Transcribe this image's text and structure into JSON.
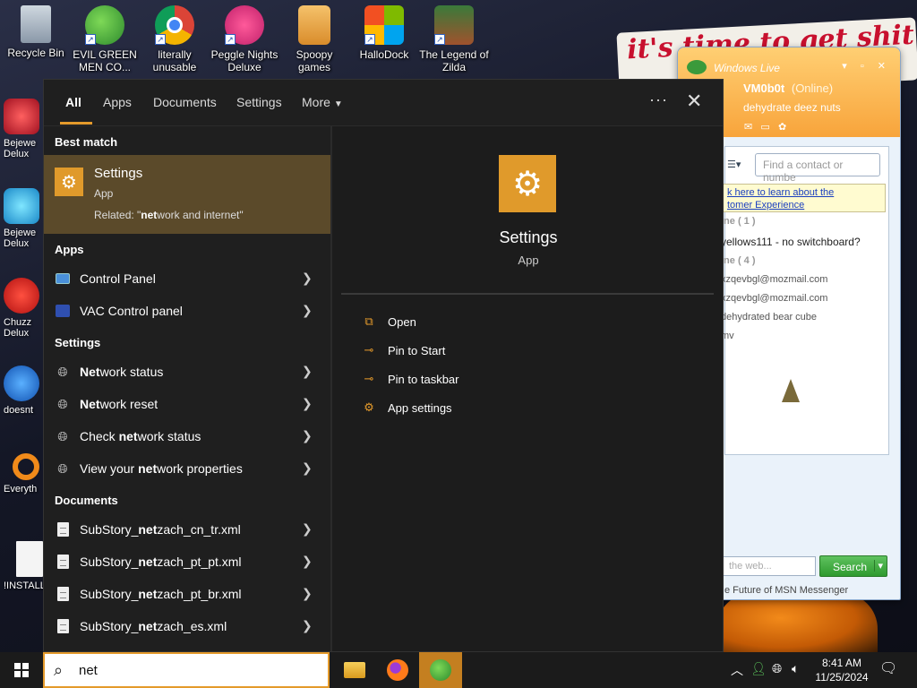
{
  "desktop": {
    "top_icons": [
      {
        "label": "Recycle Bin"
      },
      {
        "label": "EVIL GREEN MEN CO..."
      },
      {
        "label": "literally unusable"
      },
      {
        "label": "Peggle Nights Deluxe"
      },
      {
        "label": "Spoopy games"
      },
      {
        "label": "HalloDock"
      },
      {
        "label": "The Legend of Zilda"
      }
    ],
    "left_icons": [
      {
        "label": "Bejewe Delux"
      },
      {
        "label": "Bejewe Delux"
      },
      {
        "label": "Chuzz Delux"
      },
      {
        "label": "doesnt"
      },
      {
        "label": "Everyth"
      },
      {
        "label": "!INSTALL"
      }
    ],
    "wallpaper_text": "it's time to get shit"
  },
  "msn": {
    "title": "Windows Live",
    "username": "VM0b0t",
    "status": "(Online)",
    "personal_message": "dehydrate deez nuts",
    "find_placeholder": "Find a contact or numbe",
    "promo_line1": "k here to learn about the",
    "promo_line2": "tomer Experience",
    "contacts": [
      {
        "text": "ine ( 1 )",
        "kind": "group"
      },
      {
        "text": "yellows111 - no switchboard?",
        "kind": "dark"
      },
      {
        "text": "ine ( 4 )",
        "kind": "group"
      },
      {
        "text": "xzqevbgl@mozmail.com",
        "kind": "normal"
      },
      {
        "text": "xzqevbgl@mozmail.com",
        "kind": "normal"
      },
      {
        "text": "dehydrated bear cube",
        "kind": "normal"
      },
      {
        "text": "mv",
        "kind": "normal"
      }
    ],
    "search_placeholder": "the web...",
    "search_button": "Search",
    "footer": "e Future of MSN Messenger"
  },
  "search_panel": {
    "tabs": [
      {
        "label": "All",
        "active": true
      },
      {
        "label": "Apps",
        "active": false
      },
      {
        "label": "Documents",
        "active": false
      },
      {
        "label": "Settings",
        "active": false
      },
      {
        "label": "More",
        "active": false
      }
    ],
    "dots": "···",
    "close": "✕",
    "best_match_header": "Best match",
    "best_match": {
      "title": "Settings",
      "subtitle": "App",
      "related_prefix": "Related: \"",
      "related_bold": "net",
      "related_rest": "work and internet\""
    },
    "apps_header": "Apps",
    "apps": [
      {
        "label": "Control Panel"
      },
      {
        "label": "VAC Control panel"
      }
    ],
    "settings_header": "Settings",
    "settings": [
      {
        "pre": "",
        "bold": "Net",
        "post": "work status"
      },
      {
        "pre": "",
        "bold": "Net",
        "post": "work reset"
      },
      {
        "pre": "Check ",
        "bold": "net",
        "post": "work status"
      },
      {
        "pre": "View your ",
        "bold": "net",
        "post": "work properties"
      }
    ],
    "documents_header": "Documents",
    "documents": [
      {
        "pre": "SubStory_",
        "bold": "net",
        "post": "zach_cn_tr.xml"
      },
      {
        "pre": "SubStory_",
        "bold": "net",
        "post": "zach_pt_pt.xml"
      },
      {
        "pre": "SubStory_",
        "bold": "net",
        "post": "zach_pt_br.xml"
      },
      {
        "pre": "SubStory_",
        "bold": "net",
        "post": "zach_es.xml"
      }
    ],
    "preview": {
      "title": "Settings",
      "subtitle": "App",
      "actions": [
        {
          "label": "Open",
          "icon": "open-icon"
        },
        {
          "label": "Pin to Start",
          "icon": "pin-icon"
        },
        {
          "label": "Pin to taskbar",
          "icon": "pin-icon"
        },
        {
          "label": "App settings",
          "icon": "gear-icon"
        }
      ]
    }
  },
  "taskbar": {
    "search_value": "net",
    "time": "8:41 AM",
    "date": "11/25/2024",
    "accent": "#e49a2b"
  }
}
